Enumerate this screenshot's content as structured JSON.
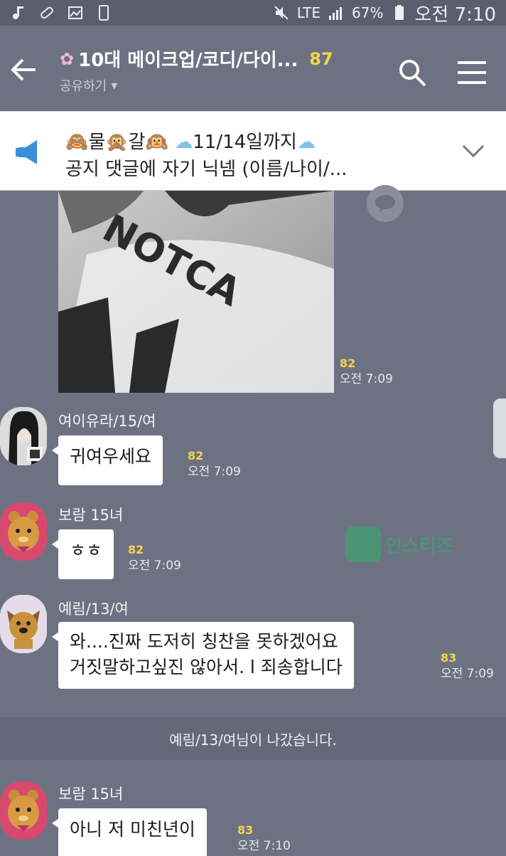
{
  "status_bar": {
    "network": "LTE",
    "battery": "67%",
    "time": "오전 7:10"
  },
  "header": {
    "title": "10대 메이크업/코디/다이...",
    "member_count": "87",
    "share_label": "공유하기"
  },
  "notice": {
    "line1_prefix": "물",
    "line1_middle": "갈",
    "line1_date": "11/14일까지",
    "line2": "공지 댓글에 자기 닉넴 (이름/나이/..."
  },
  "messages": [
    {
      "kind": "photo",
      "unread": "82",
      "time": "오전 7:09"
    },
    {
      "kind": "text",
      "sender": "여이유라/15/여",
      "text": "귀여우세요",
      "unread": "82",
      "time": "오전 7:09"
    },
    {
      "kind": "text",
      "sender": "보람 15녀",
      "text": "ㅎㅎ",
      "unread": "82",
      "time": "오전 7:09"
    },
    {
      "kind": "text",
      "sender": "예림/13/여",
      "text_line1": "와....진짜 도저히 칭찬을 못하겠어요",
      "text_line2": "거짓말하고싶진 않아서. l  죄송합니다",
      "unread": "83",
      "time": "오전 7:09"
    },
    {
      "kind": "system",
      "text": "예림/13/여님이 나갔습니다."
    },
    {
      "kind": "text",
      "sender": "보람 15녀",
      "text": "아니 저 미친년이",
      "unread": "83",
      "time": "오전 7:10"
    }
  ],
  "watermark": "인스티즈",
  "icons": [
    "back-arrow-icon",
    "search-icon",
    "menu-icon",
    "megaphone-icon",
    "chevron-down-icon",
    "speech-bubble-icon"
  ]
}
